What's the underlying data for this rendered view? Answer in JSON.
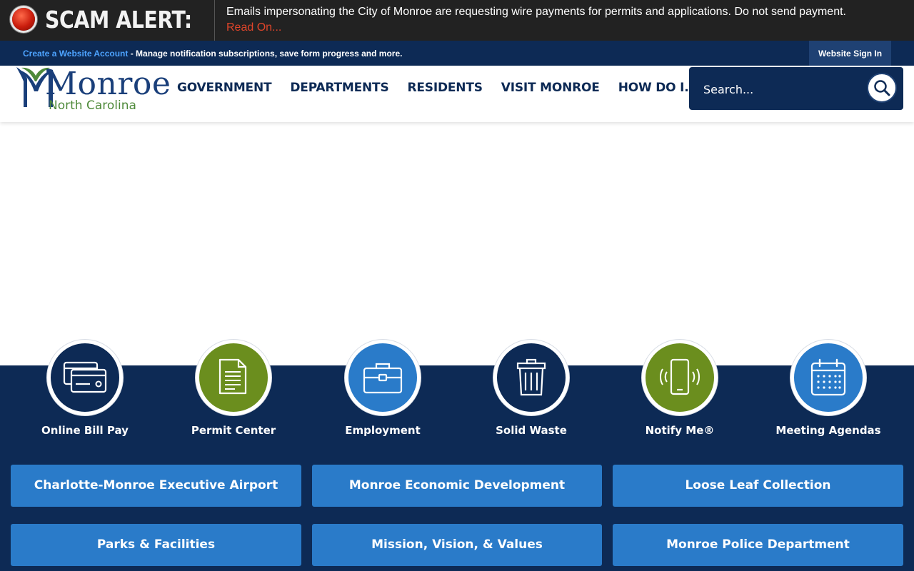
{
  "alert": {
    "title": "SCAM ALERT:",
    "message": "Emails impersonating the City of Monroe are requesting wire payments for permits and applications. Do not send payment.",
    "link": "Read On...",
    "colors": {
      "background": "#222222",
      "link": "#e0452a"
    }
  },
  "account_bar": {
    "create_link": "Create a Website Account",
    "description": " - Manage notification subscriptions, save form progress and more.",
    "sign_in": "Website Sign In"
  },
  "header": {
    "logo": {
      "name": "Monroe",
      "subtitle": "North Carolina",
      "icon": "monroe-m-logo"
    },
    "nav": [
      "GOVERNMENT",
      "DEPARTMENTS",
      "RESIDENTS",
      "VISIT MONROE",
      "HOW DO I..."
    ],
    "search": {
      "placeholder": "Search...",
      "icon": "search-icon"
    }
  },
  "quick_links": [
    {
      "label": "Online Bill Pay",
      "icon": "credit-card-icon",
      "color": "#0d2a55"
    },
    {
      "label": "Permit Center",
      "icon": "document-icon",
      "color": "#6b8e1e"
    },
    {
      "label": "Employment",
      "icon": "briefcase-icon",
      "color": "#2a7bc9"
    },
    {
      "label": "Solid Waste",
      "icon": "trash-can-icon",
      "color": "#0d2a55"
    },
    {
      "label": "Notify Me®",
      "icon": "phone-notification-icon",
      "color": "#6b8e1e"
    },
    {
      "label": "Meeting Agendas",
      "icon": "calendar-icon",
      "color": "#2a7bc9"
    }
  ],
  "tiles": [
    "Charlotte-Monroe Executive Airport",
    "Monroe Economic Development",
    "Loose Leaf Collection",
    "Parks & Facilities",
    "Mission, Vision, & Values",
    "Monroe Police Department"
  ],
  "colors": {
    "navy": "#0d2a55",
    "blue": "#2a7bc9",
    "green": "#6b8e1e",
    "logo_blue": "#1a3f7a",
    "logo_green": "#4e8a3a"
  }
}
